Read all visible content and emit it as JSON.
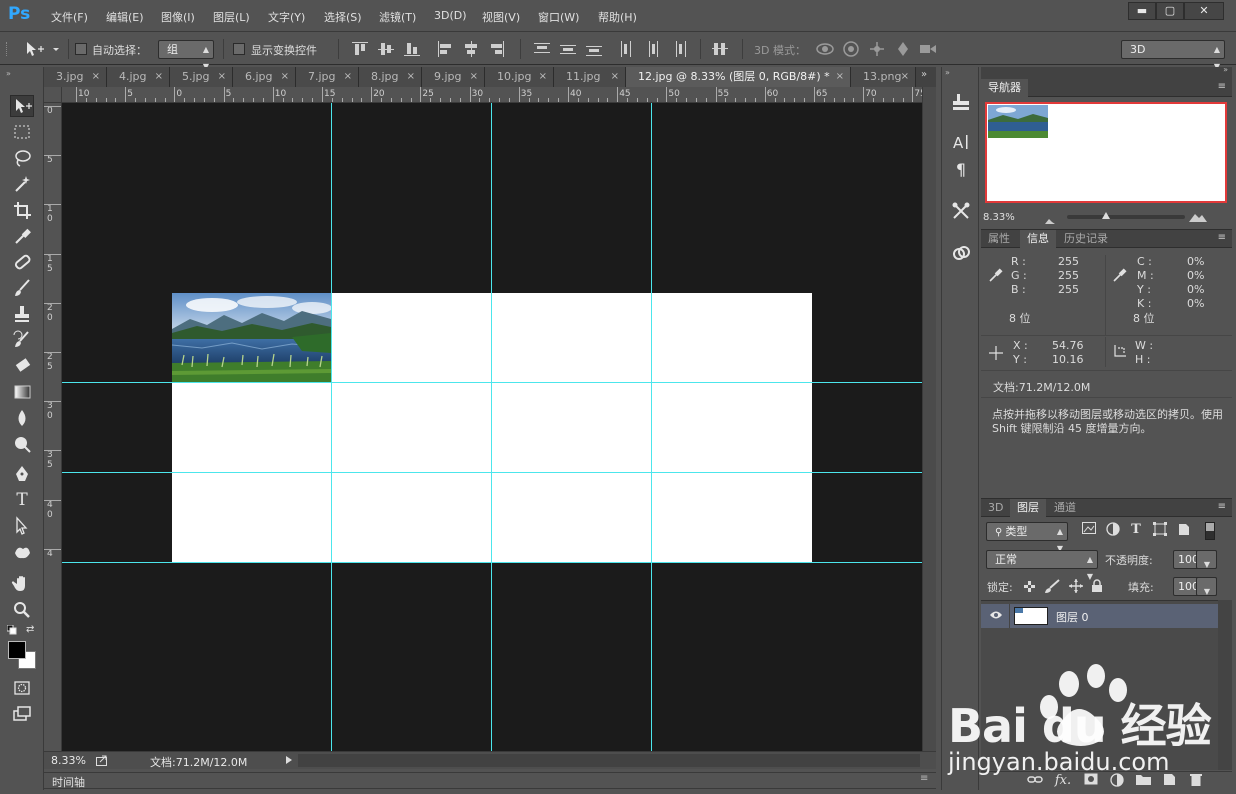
{
  "app": {
    "logo": "Ps"
  },
  "menu": [
    "文件(F)",
    "编辑(E)",
    "图像(I)",
    "图层(L)",
    "文字(Y)",
    "选择(S)",
    "滤镜(T)",
    "3D(D)",
    "视图(V)",
    "窗口(W)",
    "帮助(H)"
  ],
  "window_controls": {
    "minimize": "▬",
    "maximize": "▢",
    "close": "✕"
  },
  "options": {
    "auto_select_label": "自动选择：",
    "auto_select_value": "组",
    "show_transform_label": "显示变换控件",
    "mode_3d_label": "3D 模式：",
    "workspace_value": "3D"
  },
  "tabs": [
    {
      "label": "3.jpg",
      "active": false
    },
    {
      "label": "4.jpg",
      "active": false
    },
    {
      "label": "5.jpg",
      "active": false
    },
    {
      "label": "6.jpg",
      "active": false
    },
    {
      "label": "7.jpg",
      "active": false
    },
    {
      "label": "8.jpg",
      "active": false
    },
    {
      "label": "9.jpg",
      "active": false
    },
    {
      "label": "10.jpg",
      "active": false
    },
    {
      "label": "11.jpg",
      "active": false
    },
    {
      "label": "12.jpg @ 8.33% (图层 0, RGB/8#) *",
      "active": true
    },
    {
      "label": "13.png",
      "active": false
    }
  ],
  "tab_close_glyph": "×",
  "ruler_top": [
    "10",
    "5",
    "0",
    "5",
    "10",
    "15",
    "20",
    "25",
    "30",
    "35",
    "40",
    "45",
    "50",
    "55",
    "60",
    "65",
    "70",
    "75"
  ],
  "ruler_left": [
    "0",
    "5",
    "1 0",
    "1 5",
    "2 0",
    "2 5",
    "3 0",
    "3 5",
    "4 0",
    "4"
  ],
  "status": {
    "zoom": "8.33%",
    "doc_info": "文档:71.2M/12.0M"
  },
  "timeline_label": "时间轴",
  "navigator": {
    "tab": "导航器",
    "zoom": "8.33%"
  },
  "info_panel": {
    "tabs": [
      "属性",
      "信息",
      "历史记录"
    ],
    "active_tab": "信息",
    "rgb": {
      "r_label": "R :",
      "g_label": "G :",
      "b_label": "B :",
      "r": "255",
      "g": "255",
      "b": "255"
    },
    "cmyk": {
      "c_label": "C :",
      "m_label": "M :",
      "y_label": "Y :",
      "k_label": "K :",
      "c": "0%",
      "m": "0%",
      "y": "0%",
      "k": "0%"
    },
    "bit_left": "8 位",
    "bit_right": "8 位",
    "xy": {
      "x_label": "X :",
      "y_label": "Y :",
      "x": "54.76",
      "y": "10.16"
    },
    "wh": {
      "w_label": "W :",
      "h_label": "H :"
    },
    "doc": "文档:71.2M/12.0M",
    "hint": "点按并拖移以移动图层或移动选区的拷贝。使用 Shift 键限制沿 45 度增量方向。"
  },
  "layers_panel": {
    "tabs": [
      "3D",
      "图层",
      "通道"
    ],
    "active_tab": "图层",
    "filter_label": "类型",
    "blend_mode": "正常",
    "opacity_label": "不透明度:",
    "opacity": "100%",
    "lock_label": "锁定:",
    "fill_label": "填充:",
    "fill": "100%",
    "layers": [
      {
        "name": "图层 0",
        "visible": true
      }
    ]
  },
  "watermark": {
    "brand": "Bai du 经验",
    "url": "jingyan.baidu.com"
  },
  "colors": {
    "guide": "#4ce6ec",
    "accent": "#31a8ff",
    "navigator_frame": "#e23a3a"
  }
}
